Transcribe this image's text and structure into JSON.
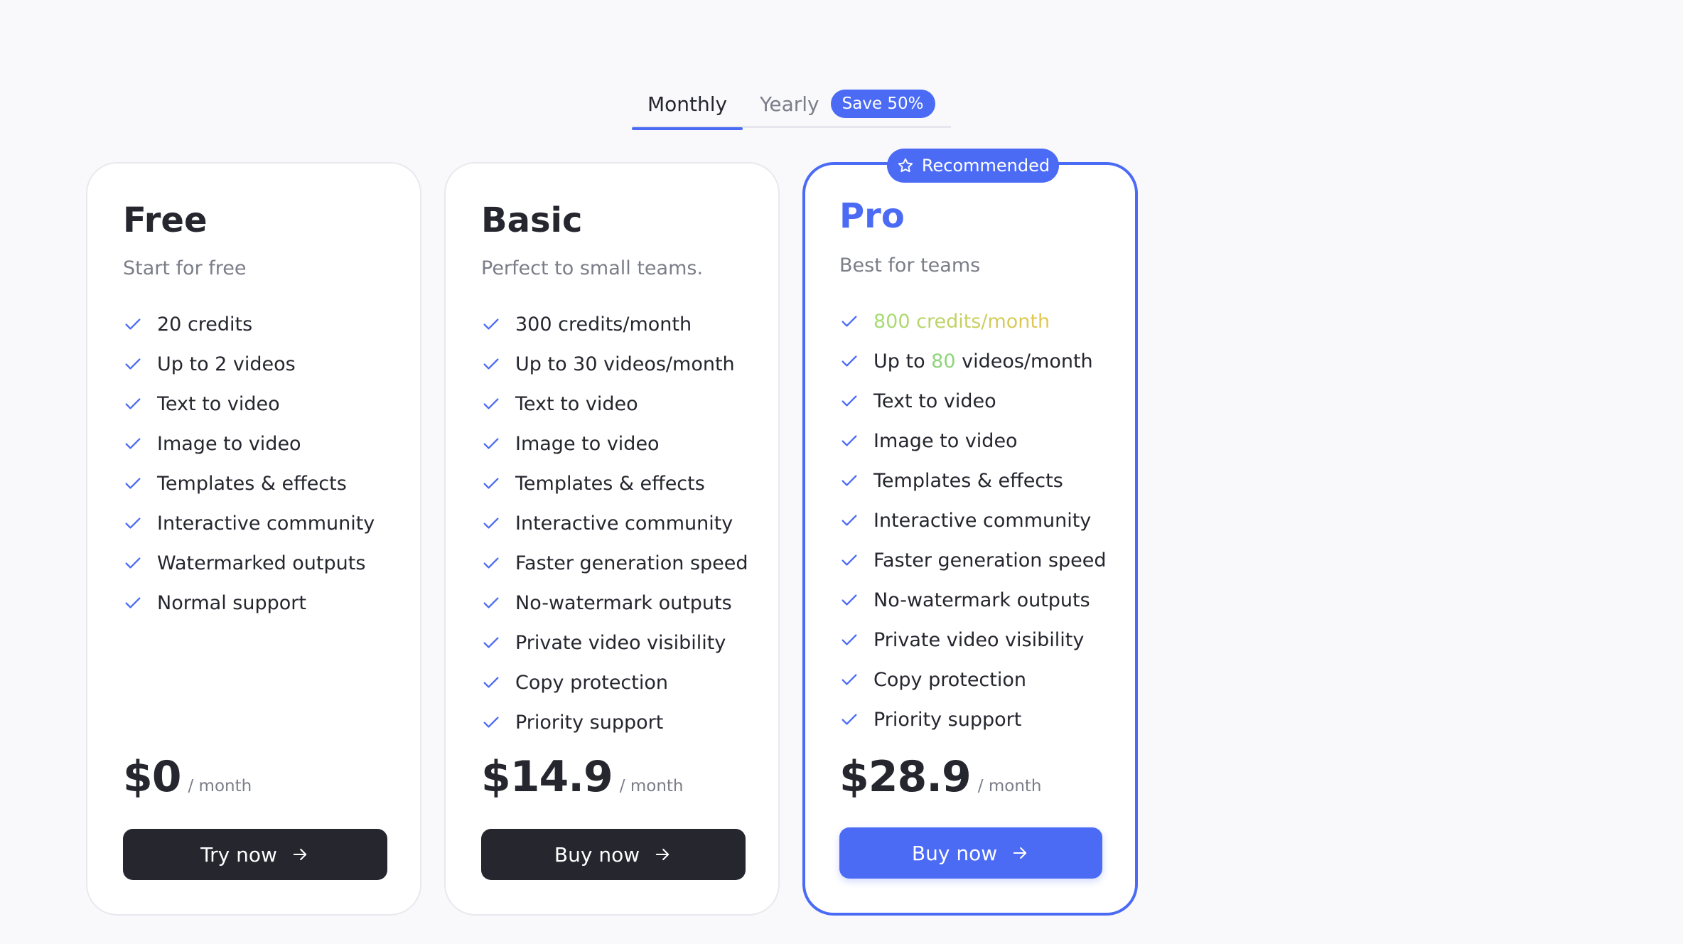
{
  "billing_toggle": {
    "monthly_label": "Monthly",
    "yearly_label": "Yearly",
    "save_badge": "Save 50%",
    "selected": "Monthly"
  },
  "colors": {
    "accent": "#4b6bf5",
    "dark_button": "#25262e",
    "muted_text": "#7b7d88",
    "highlight_green": "#8fd57a",
    "highlight_yellow": "#e6c54f"
  },
  "plans": [
    {
      "name": "Free",
      "description": "Start for free",
      "features": [
        "20 credits",
        "Up to 2 videos",
        "Text to video",
        "Image to video",
        "Templates & effects",
        "Interactive community",
        "Watermarked outputs",
        "Normal support"
      ],
      "price": "$0",
      "period": "/ month",
      "cta": "Try now"
    },
    {
      "name": "Basic",
      "description": "Perfect to small teams.",
      "features": [
        "300 credits/month",
        "Up to 30 videos/month",
        "Text to video",
        "Image to video",
        "Templates & effects",
        "Interactive community",
        "Faster generation speed",
        "No-watermark outputs",
        "Private video visibility",
        "Copy protection",
        "Priority support"
      ],
      "price": "$14.9",
      "period": "/ month",
      "cta": "Buy now"
    },
    {
      "name": "Pro",
      "badge": "Recommended",
      "description": "Best for teams",
      "features_highlight": {
        "credits": "800 credits/month",
        "videos_prefix": "Up to ",
        "videos_number": "80",
        "videos_suffix": " videos/month"
      },
      "features": [
        "Text to video",
        "Image to video",
        "Templates & effects",
        "Interactive community",
        "Faster generation speed",
        "No-watermark outputs",
        "Private video visibility",
        "Copy protection",
        "Priority support"
      ],
      "price": "$28.9",
      "period": "/ month",
      "cta": "Buy now"
    }
  ]
}
